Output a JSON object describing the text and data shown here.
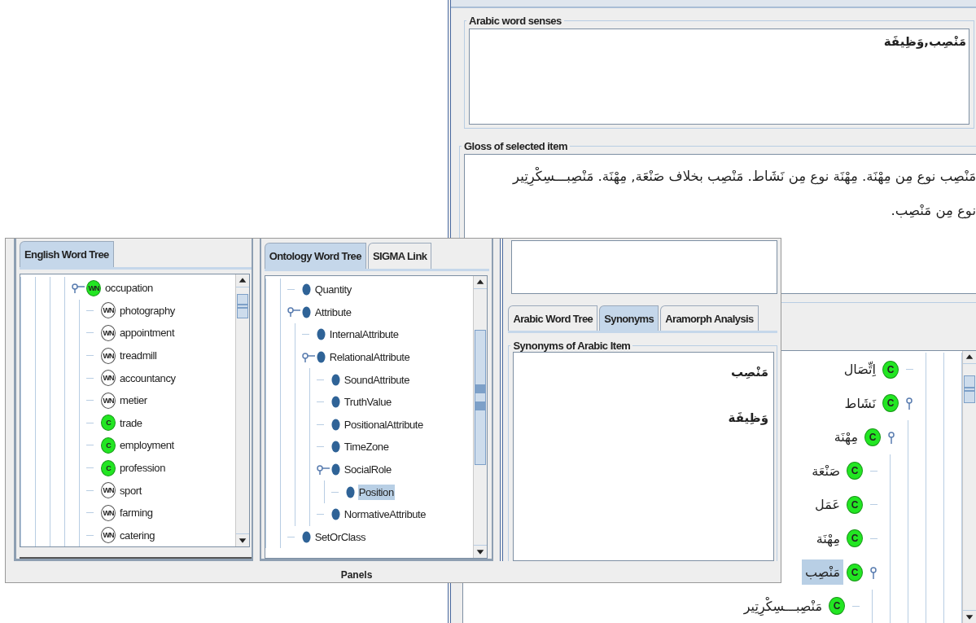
{
  "gloss_window": {
    "word_senses": {
      "title": "Arabic word senses",
      "text": "مَنْصِب,وَظِيفَة"
    },
    "gloss": {
      "title": "Gloss of selected item",
      "lines": [
        "مَنْصِب نوع مِن مِهْنَة. مِهْنَة نوع مِن نَشَاط. مَنْصِب بخلاف صَنْعَة, مِهْنَة. مَنْصِبـــسِكْرِتِير",
        "نوع مِن مَنْصِب."
      ]
    },
    "arabic_tree": [
      {
        "label": "اِتِّصَال",
        "badge": "C",
        "selected": false
      },
      {
        "label": "نَشَاط",
        "badge": "C",
        "selected": false,
        "children": [
          {
            "label": "مِهْنَة",
            "badge": "C",
            "selected": false,
            "children": [
              {
                "label": "صَنْعَة",
                "badge": "C",
                "selected": false
              },
              {
                "label": "عَمَل",
                "badge": "C",
                "selected": false
              },
              {
                "label": "مِهْنَة",
                "badge": "C",
                "selected": false
              },
              {
                "label": "مَنْصِب",
                "badge": "C",
                "selected": true,
                "children": [
                  {
                    "label": "مَنْصِبـــسِكْرِتِير",
                    "badge": "C",
                    "selected": false
                  }
                ]
              }
            ]
          }
        ]
      }
    ]
  },
  "panels_window": {
    "english_panel": {
      "tabs": [
        {
          "label": "English Word Tree",
          "selected": true
        }
      ],
      "tree": [
        {
          "label": "occupation",
          "badge": "WN",
          "mapped": true,
          "children": [
            {
              "label": "photography",
              "badge": "WN",
              "mapped": false
            },
            {
              "label": "appointment",
              "badge": "WN",
              "mapped": false
            },
            {
              "label": "treadmill",
              "badge": "WN",
              "mapped": false
            },
            {
              "label": "accountancy",
              "badge": "WN",
              "mapped": false
            },
            {
              "label": "metier",
              "badge": "WN",
              "mapped": false
            },
            {
              "label": "trade",
              "badge": "C",
              "mapped": true
            },
            {
              "label": "employment",
              "badge": "C",
              "mapped": true
            },
            {
              "label": "profession",
              "badge": "C",
              "mapped": true
            },
            {
              "label": "sport",
              "badge": "WN",
              "mapped": false
            },
            {
              "label": "farming",
              "badge": "WN",
              "mapped": false
            },
            {
              "label": "catering",
              "badge": "WN",
              "mapped": false
            }
          ]
        }
      ]
    },
    "ontology_panel": {
      "tabs": [
        {
          "label": "Ontology Word Tree",
          "selected": true
        },
        {
          "label": "SIGMA Link",
          "selected": false
        }
      ],
      "tree": [
        {
          "label": "Quantity",
          "selected": false
        },
        {
          "label": "Attribute",
          "selected": false,
          "children": [
            {
              "label": "InternalAttribute",
              "selected": false
            },
            {
              "label": "RelationalAttribute",
              "selected": false,
              "children": [
                {
                  "label": "SoundAttribute",
                  "selected": false
                },
                {
                  "label": "TruthValue",
                  "selected": false
                },
                {
                  "label": "PositionalAttribute",
                  "selected": false
                },
                {
                  "label": "TimeZone",
                  "selected": false
                },
                {
                  "label": "SocialRole",
                  "selected": false,
                  "children": [
                    {
                      "label": "Position",
                      "selected": true
                    }
                  ]
                },
                {
                  "label": "NormativeAttribute",
                  "selected": false
                }
              ]
            }
          ]
        },
        {
          "label": "SetOrClass",
          "selected": false
        }
      ]
    },
    "arabic_panel": {
      "tabs": [
        {
          "label": "Arabic Word Tree",
          "selected": false
        },
        {
          "label": "Synonyms",
          "selected": true
        },
        {
          "label": "Aramorph Analysis",
          "selected": false
        }
      ],
      "synonyms": {
        "title": "Synonyms of Arabic Item",
        "items": [
          "مَنْصِب",
          "وَظِيفَة"
        ]
      }
    },
    "footer": "Panels"
  }
}
